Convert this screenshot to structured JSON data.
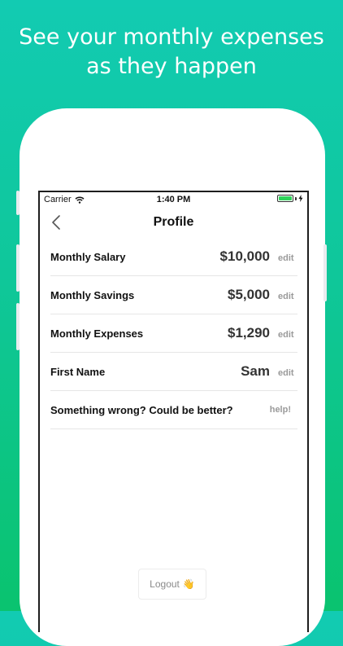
{
  "promo": {
    "line1": "See your monthly expenses",
    "line2": "as they happen"
  },
  "status": {
    "carrier": "Carrier",
    "time": "1:40 PM",
    "battery_color": "#2fd35a"
  },
  "nav": {
    "title": "Profile",
    "back_icon": "chevron-left-icon"
  },
  "profile": {
    "rows": [
      {
        "label": "Monthly Salary",
        "value": "$10,000",
        "action": "edit"
      },
      {
        "label": "Monthly Savings",
        "value": "$5,000",
        "action": "edit"
      },
      {
        "label": "Monthly Expenses",
        "value": "$1,290",
        "action": "edit"
      },
      {
        "label": "First Name",
        "value": "Sam",
        "action": "edit"
      }
    ],
    "help_row": {
      "label": "Something wrong? Could be better?",
      "action": "help!"
    }
  },
  "logout": {
    "label": "Logout",
    "icon": "👋"
  },
  "colors": {
    "background_top": "#12cbb2",
    "background_bottom": "#0ac36f"
  }
}
